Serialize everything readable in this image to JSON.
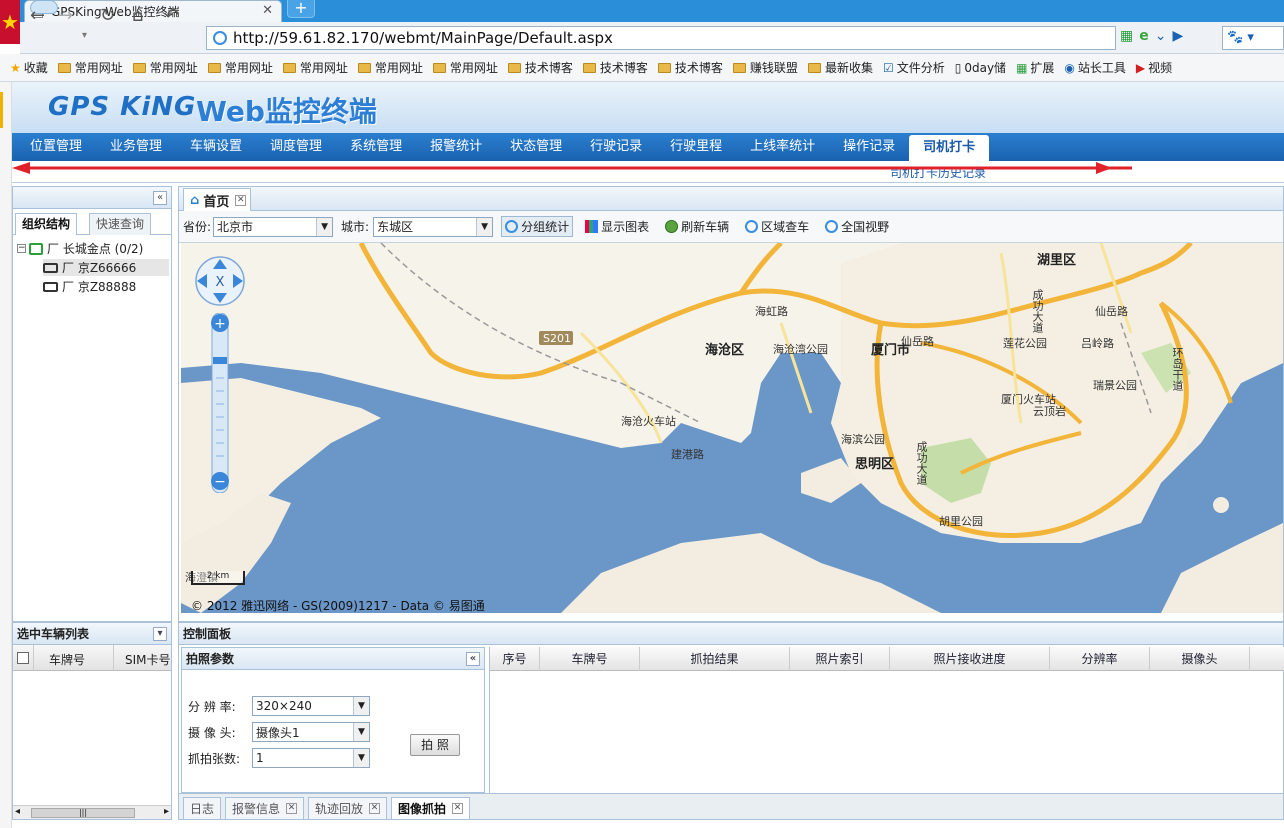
{
  "browser": {
    "tab_title": "GPSKing Web监控终端",
    "new_tab": "+",
    "url": "http://59.61.82.170/webmt/MainPage/Default.aspx",
    "favorites": [
      {
        "label": "收藏",
        "type": "star"
      },
      {
        "label": "常用网址",
        "type": "folder"
      },
      {
        "label": "常用网址",
        "type": "folder"
      },
      {
        "label": "常用网址",
        "type": "folder"
      },
      {
        "label": "常用网址",
        "type": "folder"
      },
      {
        "label": "常用网址",
        "type": "folder"
      },
      {
        "label": "常用网址",
        "type": "folder"
      },
      {
        "label": "技术博客",
        "type": "folder"
      },
      {
        "label": "技术博客",
        "type": "folder"
      },
      {
        "label": "技术博客",
        "type": "folder"
      },
      {
        "label": "赚钱联盟",
        "type": "folder"
      },
      {
        "label": "最新收集",
        "type": "folder"
      },
      {
        "label": "文件分析",
        "type": "check"
      },
      {
        "label": "0day储",
        "type": "doc"
      },
      {
        "label": "扩展",
        "type": "grid"
      },
      {
        "label": "站长工具",
        "type": "w"
      },
      {
        "label": "视频",
        "type": "video"
      }
    ]
  },
  "app": {
    "logo_gps": "GPS KiNG",
    "logo_web": "Web监控终端",
    "menu": [
      "位置管理",
      "业务管理",
      "车辆设置",
      "调度管理",
      "系统管理",
      "报警统计",
      "状态管理",
      "行驶记录",
      "行驶里程",
      "上线率统计",
      "操作记录",
      "司机打卡"
    ],
    "active_menu": "司机打卡",
    "submenu": "司机打卡历史记录"
  },
  "left_panel": {
    "tabs": [
      "组织结构",
      "快速查询"
    ],
    "tree_root": "厂 长城金点 (0/2)",
    "vehicles": [
      "厂 京Z66666",
      "厂 京Z88888"
    ]
  },
  "content": {
    "home_tab": "首页",
    "province_label": "省份:",
    "province_value": "北京市",
    "city_label": "城市:",
    "city_value": "东城区",
    "tools": [
      "分组统计",
      "显示图表",
      "刷新车辆",
      "区域查车",
      "全国视野"
    ],
    "map": {
      "labels": [
        {
          "t": "湖里区",
          "c": "#222"
        },
        {
          "t": "海沧区",
          "c": "#222"
        },
        {
          "t": "厦门市",
          "c": "#222"
        },
        {
          "t": "思明区",
          "c": "#222"
        },
        {
          "t": "云顶岩",
          "c": "#333"
        },
        {
          "t": "海沧湾公园",
          "c": "#333"
        },
        {
          "t": "莲花公园",
          "c": "#333"
        },
        {
          "t": "瑞景公园",
          "c": "#333"
        },
        {
          "t": "海滨公园",
          "c": "#333"
        },
        {
          "t": "胡里公园",
          "c": "#333"
        },
        {
          "t": "海沧火车站",
          "c": "#333"
        },
        {
          "t": "厦门火车站",
          "c": "#333"
        },
        {
          "t": "建港路",
          "c": "#333"
        },
        {
          "t": "海虹路",
          "c": "#333"
        },
        {
          "t": "仙岳路",
          "c": "#333"
        },
        {
          "t": "仙岳路",
          "c": "#333"
        },
        {
          "t": "吕岭路",
          "c": "#333"
        },
        {
          "t": "成功大道",
          "c": "#333"
        },
        {
          "t": "成功大道",
          "c": "#333"
        },
        {
          "t": "环岛干道",
          "c": "#333"
        },
        {
          "t": "S201",
          "c": "#fff"
        },
        {
          "t": "海澄镇",
          "c": "#333"
        }
      ],
      "scale": "2 km",
      "copyright": "© 2012 雅迅网络 - GS(2009)1217 - Data © 易图通"
    }
  },
  "selected_panel": {
    "title": "选中车辆列表",
    "cols": [
      "车牌号",
      "SIM卡号"
    ]
  },
  "control_panel": {
    "title": "控制面板",
    "snap_title": "拍照参数",
    "fields": [
      {
        "label": "分 辨 率:",
        "value": "320×240"
      },
      {
        "label": "摄 像 头:",
        "value": "摄像头1"
      },
      {
        "label": "抓拍张数:",
        "value": "1"
      }
    ],
    "snap_button": "拍 照",
    "grid_cols": [
      "序号",
      "车牌号",
      "抓拍结果",
      "照片索引",
      "照片接收进度",
      "分辨率",
      "摄像头"
    ],
    "bottom_tabs": [
      "日志",
      "报警信息",
      "轨迹回放",
      "图像抓拍"
    ],
    "active_bottom_tab": "图像抓拍"
  }
}
